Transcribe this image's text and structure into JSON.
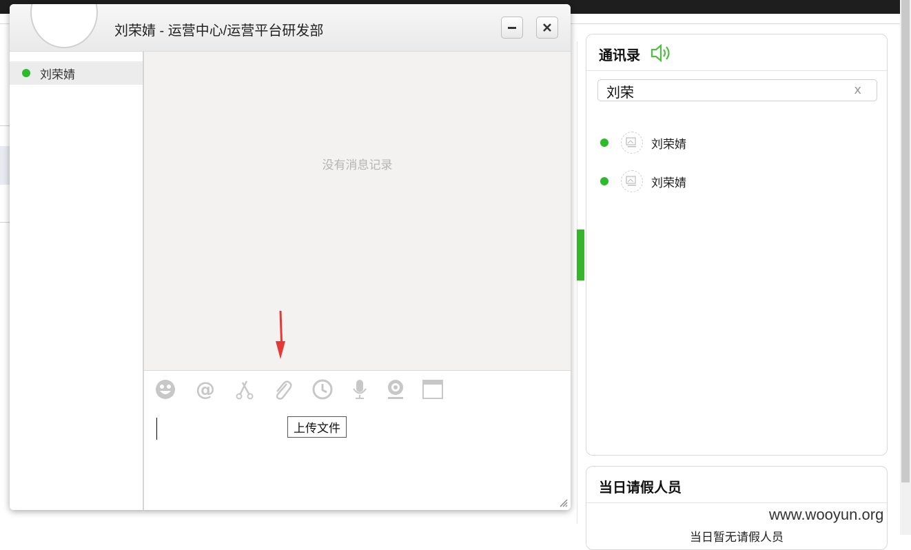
{
  "chat": {
    "title": "刘荣婧 - 运营中心/运营平台研发部",
    "contacts": [
      {
        "name": "刘荣婧",
        "status": "online"
      }
    ],
    "empty_message": "没有消息记录",
    "toolbar_icons": [
      "emoji-icon",
      "mention-icon",
      "screenshot-icon",
      "attachment-icon",
      "history-icon",
      "voice-icon",
      "video-icon",
      "window-icon"
    ],
    "tooltip": "上传文件"
  },
  "address_book": {
    "title": "通讯录",
    "search": {
      "value": "刘荣",
      "clear_label": "x"
    },
    "results": [
      {
        "name": "刘荣婧",
        "status": "online"
      },
      {
        "name": "刘荣婧",
        "status": "online"
      }
    ]
  },
  "leave": {
    "title": "当日请假人员",
    "empty_message": "当日暂无请假人员"
  },
  "watermark": "www.wooyun.org",
  "colors": {
    "online": "#2bbb2b",
    "accent_green": "#38b62b",
    "arrow": "#e53935"
  }
}
